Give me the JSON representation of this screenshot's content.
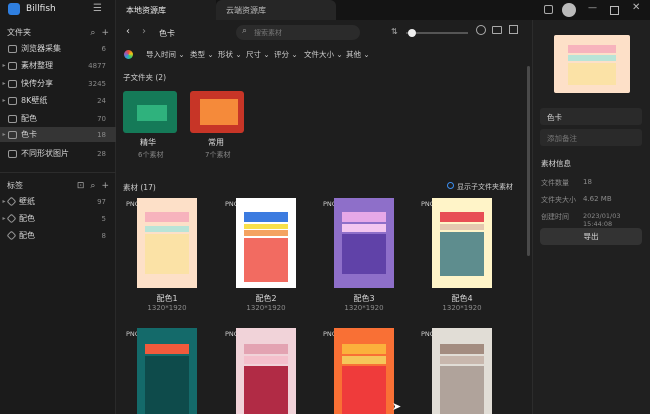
{
  "app": {
    "name": "Billfish"
  },
  "tabs": [
    {
      "label": "本地资源库"
    },
    {
      "label": "云端资源库"
    }
  ],
  "sidebar": {
    "folders_title": "文件夹",
    "folders": [
      {
        "label": "浏览器采集",
        "count": "6"
      },
      {
        "label": "素材整理",
        "count": "4877"
      },
      {
        "label": "快传分享",
        "count": "3245"
      },
      {
        "label": "8K壁纸",
        "count": "24"
      },
      {
        "label": "配色",
        "count": "70"
      },
      {
        "label": "色卡",
        "count": "18"
      },
      {
        "label": "不同形状图片",
        "count": "28"
      }
    ],
    "tags_title": "标签",
    "tags": [
      {
        "label": "壁纸",
        "count": "97"
      },
      {
        "label": "配色",
        "count": "5"
      },
      {
        "label": "配色",
        "count": "8"
      }
    ]
  },
  "toolbar": {
    "breadcrumb": "色卡",
    "search_placeholder": "搜索素材"
  },
  "filters": [
    "导入时间",
    "类型",
    "形状",
    "尺寸",
    "评分",
    "文件大小",
    "其他"
  ],
  "subfolders": {
    "header": "子文件夹  (2)",
    "items": [
      {
        "name": "精华",
        "count": "6个素材"
      },
      {
        "name": "常用",
        "count": "7个素材"
      }
    ]
  },
  "materials": {
    "header": "素材  (17)",
    "show_sub_label": "显示子文件夹素材",
    "items": [
      {
        "name": "配色1",
        "size": "1320*1920",
        "badge": "PNG"
      },
      {
        "name": "配色2",
        "size": "1320*1920",
        "badge": "PNG"
      },
      {
        "name": "配色3",
        "size": "1320*1920",
        "badge": "PNG"
      },
      {
        "name": "配色4",
        "size": "1320*1920",
        "badge": "PNG"
      },
      {
        "badge": "PNG"
      },
      {
        "badge": "PNG"
      },
      {
        "badge": "PNG"
      },
      {
        "badge": "PNG"
      }
    ]
  },
  "right_panel": {
    "folder_name": "色卡",
    "note_placeholder": "添加备注",
    "info_title": "素材信息",
    "info": [
      {
        "key": "文件数量",
        "value": "18"
      },
      {
        "key": "文件夹大小",
        "value": "4.62 MB"
      },
      {
        "key": "创建时间",
        "value": "2023/01/03 15:44:08"
      }
    ],
    "export_label": "导出"
  },
  "colors": {
    "accent": "#3b8ef0",
    "selected": "#353535"
  }
}
